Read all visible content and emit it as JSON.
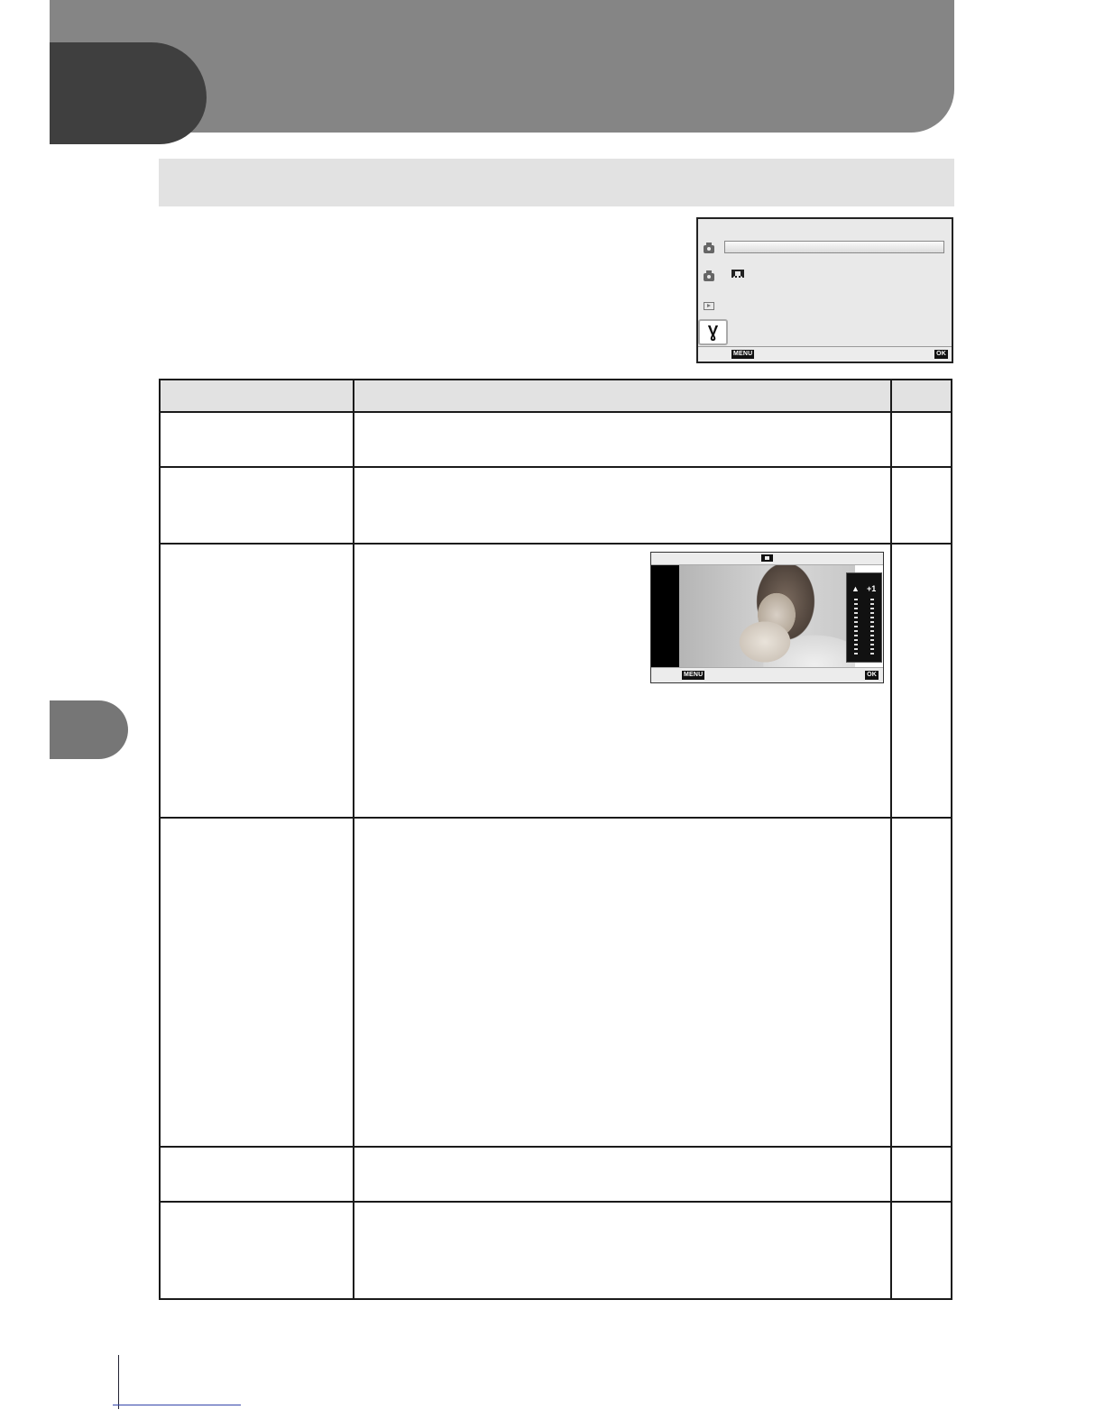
{
  "page": {
    "chapter_number": "",
    "chapter_title": "",
    "section_title": "",
    "intro_text": "",
    "side_tab_label": ""
  },
  "menu_screenshot": {
    "rows": [
      {
        "icon": "camera-icon"
      },
      {
        "icon": "camera-icon"
      },
      {
        "icon": "playback-icon"
      },
      {
        "icon": "wrench-icon",
        "selected": true
      }
    ],
    "wrench_glyph": "Ɣ",
    "footer_back": "MENU",
    "footer_ok": "OK"
  },
  "table": {
    "headers": [
      "",
      "",
      ""
    ],
    "rows": [
      {
        "option": "",
        "description": "",
        "page": ""
      },
      {
        "option": "",
        "description": "",
        "page": ""
      },
      {
        "option": "",
        "description": "",
        "page": ""
      },
      {
        "option": "",
        "description": "",
        "page": ""
      },
      {
        "option": "",
        "description": "",
        "page": ""
      },
      {
        "option": "",
        "description": "",
        "page": ""
      }
    ]
  },
  "live_view_screenshot": {
    "footer_back": "MENU",
    "footer_ok": "OK",
    "left_slider_symbol": "▲",
    "right_slider_symbol": "+1"
  },
  "colors": {
    "header_band": "#858585",
    "chapter_tab": "#3f3f3f",
    "section_bar": "#e2e2e2",
    "side_tab": "#767676"
  }
}
